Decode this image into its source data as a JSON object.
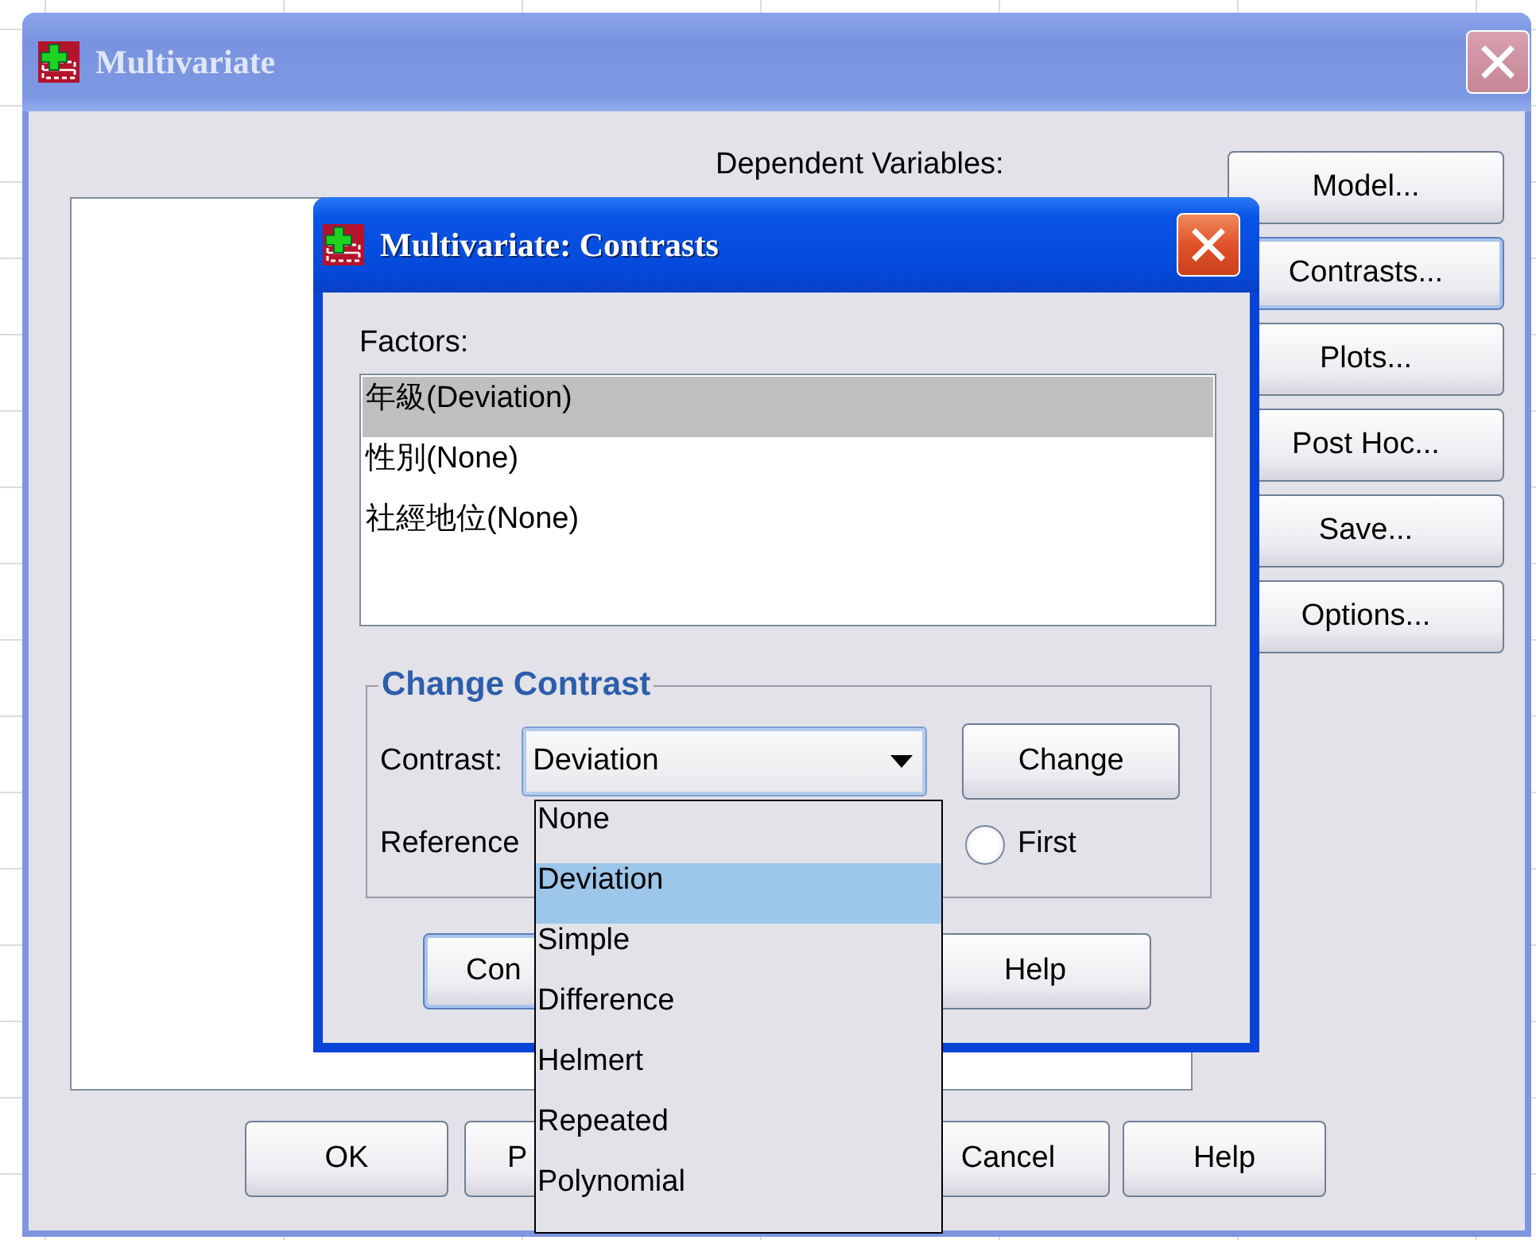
{
  "main_window": {
    "title": "Multivariate",
    "active": false,
    "dependent_label": {
      "text": "Dependent Variables:"
    },
    "side_buttons": [
      {
        "label": "Model...",
        "focused": false
      },
      {
        "label": "Contrasts...",
        "focused": true
      },
      {
        "label": "Plots...",
        "focused": false
      },
      {
        "label": "Post Hoc...",
        "focused": false
      },
      {
        "label": "Save...",
        "focused": false
      },
      {
        "label": "Options...",
        "focused": false
      }
    ],
    "bottom_buttons": [
      {
        "label": "OK",
        "focused": false
      },
      {
        "label": "P",
        "focused": false
      },
      {
        "label": "Cancel",
        "focused": false
      },
      {
        "label": "Help",
        "focused": false
      }
    ]
  },
  "contrasts_dialog": {
    "title": "Multivariate: Contrasts",
    "active": true,
    "factors_label": {
      "text": "Factors:"
    },
    "factors": [
      {
        "label": "年級(Deviation)",
        "selected": true
      },
      {
        "label": "性別(None)",
        "selected": false
      },
      {
        "label": "社經地位(None)",
        "selected": false
      }
    ],
    "group_title": "Change Contrast",
    "contrast_label": {
      "text": "Contrast:"
    },
    "contrast_value": "Deviation",
    "change_button": {
      "label": "Change",
      "focused": false
    },
    "reference_label": "Reference",
    "reference_option": {
      "label": "First",
      "selected": false
    },
    "buttons": [
      {
        "label": "Con",
        "focused": true
      },
      {
        "label": "Help",
        "focused": false
      }
    ]
  },
  "contrast_dropdown": {
    "expanded": true,
    "options": [
      {
        "label": "None",
        "selected": false
      },
      {
        "label": "Deviation",
        "selected": true
      },
      {
        "label": "Simple",
        "selected": false
      },
      {
        "label": "Difference",
        "selected": false
      },
      {
        "label": "Helmert",
        "selected": false
      },
      {
        "label": "Repeated",
        "selected": false
      },
      {
        "label": "Polynomial",
        "selected": false
      }
    ]
  }
}
